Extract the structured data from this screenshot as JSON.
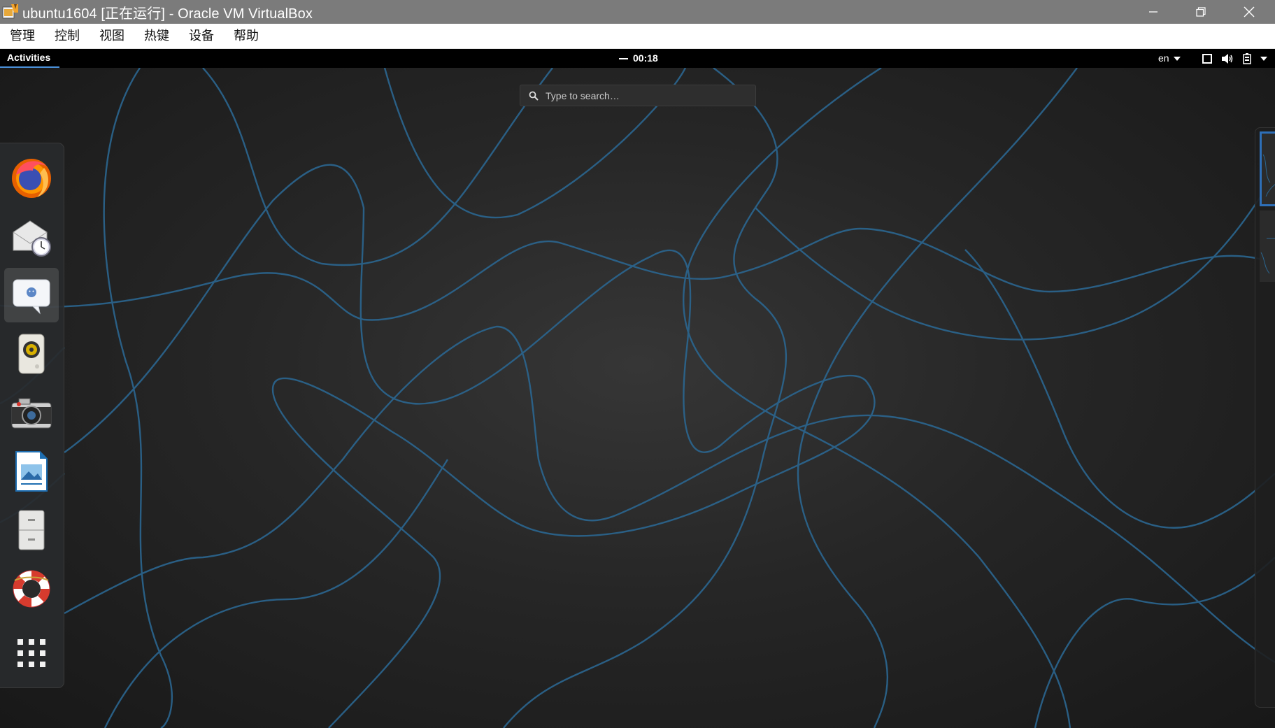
{
  "window": {
    "title": "ubuntu1604 [正在运行] - Oracle VM VirtualBox"
  },
  "menubar": {
    "items": [
      "管理",
      "控制",
      "视图",
      "热键",
      "设备",
      "帮助"
    ]
  },
  "gnome": {
    "activities_label": "Activities",
    "clock": "00:18",
    "language": "en",
    "search_placeholder": "Type to search…"
  },
  "dash": {
    "apps": [
      "firefox",
      "evolution",
      "empathy",
      "rhythmbox",
      "cheese",
      "libreoffice-draw",
      "files",
      "help"
    ],
    "active_app": "empathy",
    "show_apps": "show-applications"
  },
  "colors": {
    "titlebar": "#7b7b7b",
    "accent": "#4a90d9",
    "wallpaper_line": "#2d6a93"
  }
}
